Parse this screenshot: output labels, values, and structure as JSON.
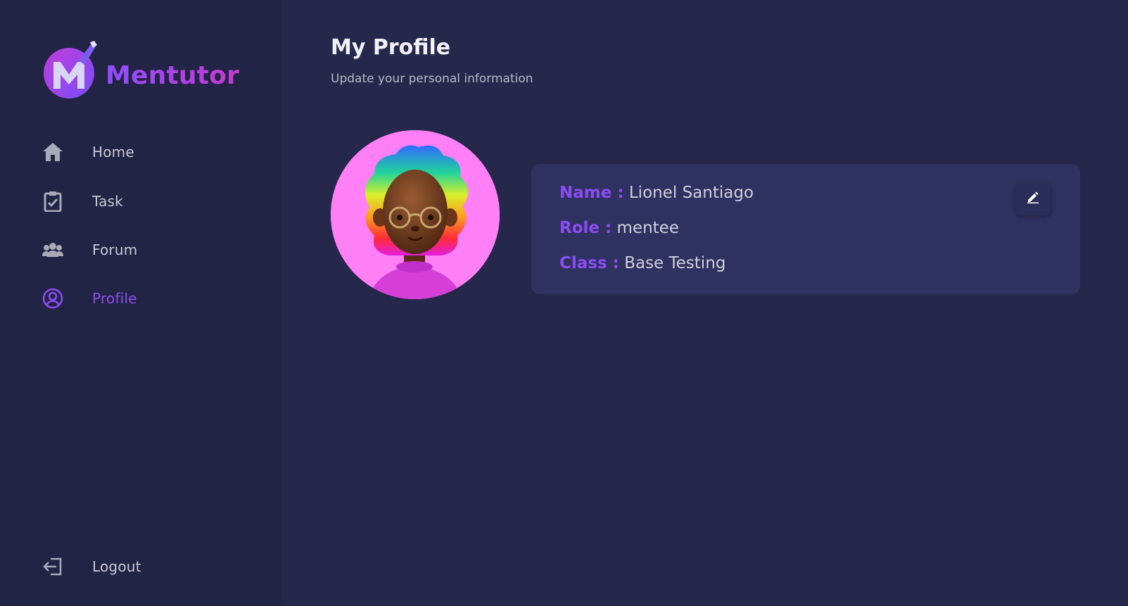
{
  "brand": {
    "name": "Mentutor",
    "logo_letter": "M"
  },
  "sidebar": {
    "items": [
      {
        "label": "Home",
        "icon": "home-icon"
      },
      {
        "label": "Task",
        "icon": "clipboard-check-icon"
      },
      {
        "label": "Forum",
        "icon": "users-icon"
      },
      {
        "label": "Profile",
        "icon": "user-circle-icon",
        "active": true
      }
    ],
    "logout": {
      "label": "Logout",
      "icon": "logout-icon"
    }
  },
  "main": {
    "title": "My Profile",
    "subtitle": "Update your personal information"
  },
  "profile": {
    "avatar": "avatar-image",
    "name_label": "Name :",
    "name_value": "Lionel Santiago",
    "role_label": "Role :",
    "role_value": "mentee",
    "class_label": "Class :",
    "class_value": "Base Testing",
    "edit_icon": "pencil-icon"
  },
  "colors": {
    "background": "#25284a",
    "sidebar": "#212444",
    "card": "#2f3260",
    "accent": "#8b4cf2",
    "avatar_bg": "#ff7ff6"
  }
}
